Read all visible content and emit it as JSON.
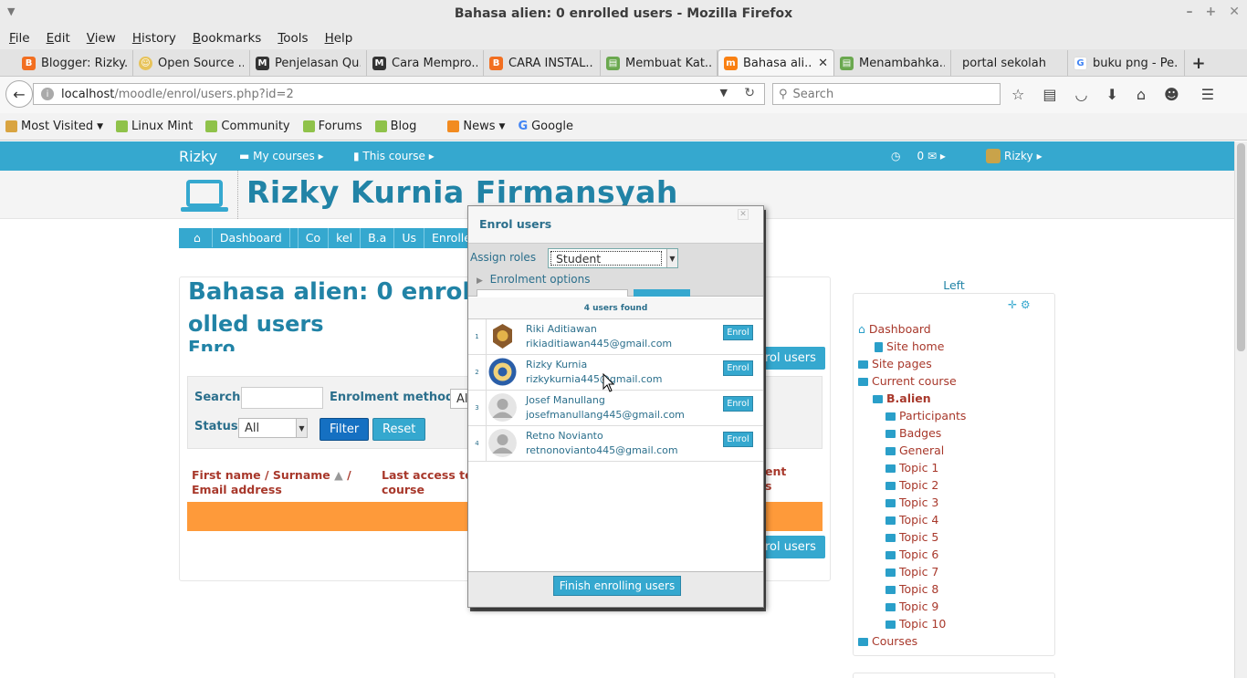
{
  "window": {
    "title": "Bahasa alien: 0 enrolled users - Mozilla Firefox"
  },
  "menubar": [
    "File",
    "Edit",
    "History",
    "Bookmarks",
    "Tools",
    "Help",
    "View"
  ],
  "menu": {
    "file": "File",
    "edit": "Edit",
    "view": "View",
    "history": "History",
    "bookmarks": "Bookmarks",
    "tools": "Tools",
    "help": "Help"
  },
  "tabs": [
    {
      "label": "Blogger: Rizky...",
      "color": "#f26f21"
    },
    {
      "label": "Open Source ...",
      "color": "#e7c35a"
    },
    {
      "label": "Penjelasan Qu...",
      "color": "#333333"
    },
    {
      "label": "Cara Mempro...",
      "color": "#333333"
    },
    {
      "label": "CARA INSTAL...",
      "color": "#f26f21"
    },
    {
      "label": "Membuat Kat...",
      "color": "#6aa84f"
    },
    {
      "label": "Bahasa ali...",
      "color": "#f98012"
    },
    {
      "label": "Menambahka...",
      "color": "#6aa84f"
    },
    {
      "label": "portal sekolah",
      "color": ""
    },
    {
      "label": "buku png - Pe...",
      "color": "#4285f4"
    }
  ],
  "urlbar": {
    "host": "localhost",
    "path": "/moodle/enrol/users.php?id=2"
  },
  "search": {
    "placeholder": "Search"
  },
  "bookmarks": {
    "most_visited": "Most Visited",
    "linux_mint": "Linux Mint",
    "community": "Community",
    "forums": "Forums",
    "blog": "Blog",
    "news": "News",
    "google": "Google"
  },
  "moodle": {
    "brand": "Rizky",
    "my_courses": "My courses",
    "this_course": "This course",
    "messages": "0",
    "user": "Rizky",
    "site_name": "Rizky Kurnia Firmansyah",
    "breadcrumb": [
      "Dashboard",
      "Co",
      "kel",
      "B.a",
      "Us",
      "Enrolle"
    ],
    "heading_1": "Bahasa alien: 0 enrol",
    "heading_2": "olled users",
    "heading_3": "Enro",
    "enrol_users_btn": "rol users",
    "filter": {
      "search_label": "Search",
      "methods_label": "Enrolment methods",
      "methods_value": "Al",
      "status_label": "Status",
      "status_value": "All",
      "filter_btn": "Filter",
      "reset_btn": "Reset"
    },
    "table": {
      "col1_a": "First name / Surname",
      "col1_b": "/",
      "col1_c": "Email address",
      "col2_a": "Last access to",
      "col2_b": "course",
      "col3_a": "ent",
      "col3_b": "s"
    }
  },
  "sidebar": {
    "title": "Left",
    "items": [
      {
        "label": "Dashboard",
        "level": 0,
        "bold": false
      },
      {
        "label": "Site home",
        "level": 1,
        "bold": false
      },
      {
        "label": "Site pages",
        "level": 0,
        "bold": false
      },
      {
        "label": "Current course",
        "level": 0,
        "bold": false
      },
      {
        "label": "B.alien",
        "level": 1,
        "bold": true
      },
      {
        "label": "Participants",
        "level": 2,
        "bold": false
      },
      {
        "label": "Badges",
        "level": 2,
        "bold": false
      },
      {
        "label": "General",
        "level": 2,
        "bold": false
      },
      {
        "label": "Topic 1",
        "level": 2,
        "bold": false
      },
      {
        "label": "Topic 2",
        "level": 2,
        "bold": false
      },
      {
        "label": "Topic 3",
        "level": 2,
        "bold": false
      },
      {
        "label": "Topic 4",
        "level": 2,
        "bold": false
      },
      {
        "label": "Topic 5",
        "level": 2,
        "bold": false
      },
      {
        "label": "Topic 6",
        "level": 2,
        "bold": false
      },
      {
        "label": "Topic 7",
        "level": 2,
        "bold": false
      },
      {
        "label": "Topic 8",
        "level": 2,
        "bold": false
      },
      {
        "label": "Topic 9",
        "level": 2,
        "bold": false
      },
      {
        "label": "Topic 10",
        "level": 2,
        "bold": false
      },
      {
        "label": "Courses",
        "level": 0,
        "bold": false
      }
    ]
  },
  "modal": {
    "title": "Enrol users",
    "assign_roles_label": "Assign roles",
    "role_value": "Student",
    "enrolment_options": "Enrolment options",
    "users_found": "4 users found",
    "users": [
      {
        "num": "1",
        "name": "Riki Aditiawan",
        "email": "rikiaditiawan445@gmail.com",
        "button": "Enrol",
        "avatar": "emblem-brown"
      },
      {
        "num": "2",
        "name": "Rizky Kurnia",
        "email": "rizkykurnia445@gmail.com",
        "button": "Enrol",
        "avatar": "emblem-blue"
      },
      {
        "num": "3",
        "name": "Josef Manullang",
        "email": "josefmanullang445@gmail.com",
        "button": "Enrol",
        "avatar": "default"
      },
      {
        "num": "4",
        "name": "Retno Novianto",
        "email": "retnonovianto445@gmail.com",
        "button": "Enrol",
        "avatar": "default"
      }
    ],
    "finish_button": "Finish enrolling users"
  }
}
